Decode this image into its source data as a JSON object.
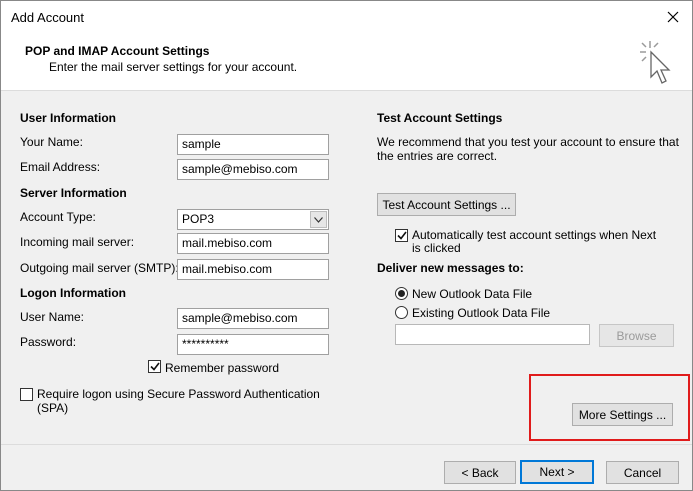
{
  "window": {
    "title": "Add Account"
  },
  "header": {
    "title": "POP and IMAP Account Settings",
    "subtitle": "Enter the mail server settings for your account."
  },
  "user_info": {
    "heading": "User Information",
    "your_name_label": "Your Name:",
    "your_name_value": "sample",
    "email_label": "Email Address:",
    "email_value": "sample@mebiso.com"
  },
  "server_info": {
    "heading": "Server Information",
    "account_type_label": "Account Type:",
    "account_type_value": "POP3",
    "incoming_label": "Incoming mail server:",
    "incoming_value": "mail.mebiso.com",
    "outgoing_label": "Outgoing mail server (SMTP):",
    "outgoing_value": "mail.mebiso.com"
  },
  "logon_info": {
    "heading": "Logon Information",
    "username_label": "User Name:",
    "username_value": "sample@mebiso.com",
    "password_label": "Password:",
    "password_value": "**********",
    "remember_label": "Remember password",
    "remember_checked": true,
    "spa_label_line1": "Require logon using Secure Password Authentication",
    "spa_label_line2": "(SPA)",
    "spa_checked": false
  },
  "test_settings": {
    "heading": "Test Account Settings",
    "desc_line1": "We recommend that you test your account to ensure that",
    "desc_line2": "the entries are correct.",
    "test_button": "Test Account Settings ...",
    "auto_test_line1": "Automatically test account settings when Next",
    "auto_test_line2": "is clicked",
    "auto_test_checked": true
  },
  "deliver": {
    "heading": "Deliver new messages to:",
    "option_new": "New Outlook Data File",
    "option_existing": "Existing Outlook Data File",
    "selected": "new",
    "path_value": "",
    "browse_button": "Browse"
  },
  "more_settings_button": "More Settings ...",
  "footer": {
    "back_button": "< Back",
    "next_button": "Next >",
    "cancel_button": "Cancel"
  },
  "colors": {
    "highlight": "#e01b1b",
    "default_button_border": "#0078d7"
  }
}
